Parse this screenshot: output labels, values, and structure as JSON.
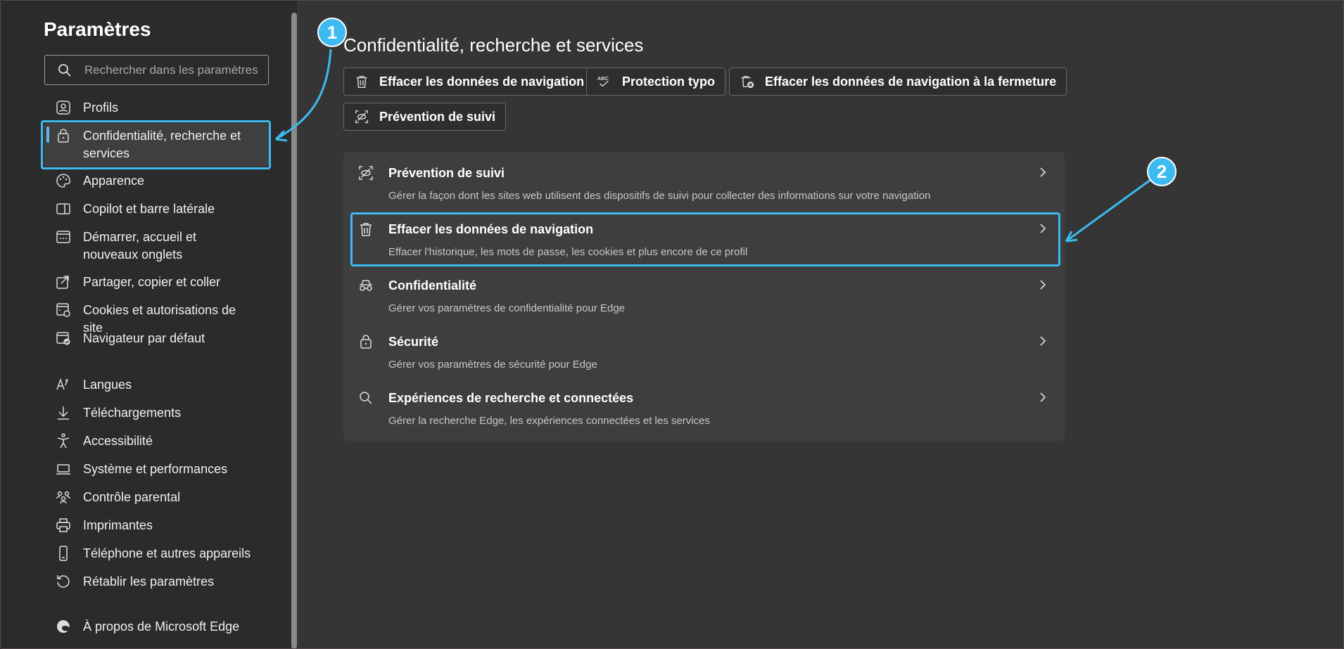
{
  "sidebar": {
    "title": "Paramètres",
    "search_placeholder": "Rechercher dans les paramètres",
    "items": [
      {
        "label": "Profils",
        "icon": "profile-icon"
      },
      {
        "label": "Confidentialité, recherche et services",
        "icon": "lock-icon",
        "active": true
      },
      {
        "label": "Apparence",
        "icon": "palette-icon"
      },
      {
        "label": "Copilot et barre latérale",
        "icon": "sidebar-icon"
      },
      {
        "label": "Démarrer, accueil et nouveaux onglets",
        "icon": "start-page-icon"
      },
      {
        "label": "Partager, copier et coller",
        "icon": "share-icon"
      },
      {
        "label": "Cookies et autorisations de site",
        "icon": "cookies-icon"
      },
      {
        "label": "Navigateur par défaut",
        "icon": "default-browser-icon"
      },
      {
        "label": "Langues",
        "icon": "languages-icon"
      },
      {
        "label": "Téléchargements",
        "icon": "download-icon"
      },
      {
        "label": "Accessibilité",
        "icon": "accessibility-icon"
      },
      {
        "label": "Système et performances",
        "icon": "laptop-icon"
      },
      {
        "label": "Contrôle parental",
        "icon": "family-icon"
      },
      {
        "label": "Imprimantes",
        "icon": "printer-icon"
      },
      {
        "label": "Téléphone et autres appareils",
        "icon": "phone-icon"
      },
      {
        "label": "Rétablir les paramètres",
        "icon": "reset-icon"
      },
      {
        "label": "À propos de Microsoft Edge",
        "icon": "edge-logo-icon"
      }
    ]
  },
  "main": {
    "title": "Confidentialité, recherche et services",
    "chips": [
      {
        "label": "Effacer les données de navigation",
        "icon": "trash-icon"
      },
      {
        "label": "Protection typo",
        "icon": "spellcheck-icon"
      },
      {
        "label": "Effacer les données de navigation à la fermeture",
        "icon": "trash-clock-icon"
      },
      {
        "label": "Prévention de suivi",
        "icon": "tracking-icon"
      }
    ],
    "rows": [
      {
        "title": "Prévention de suivi",
        "desc": "Gérer la façon dont les sites web utilisent des dispositifs de suivi pour collecter des informations sur votre navigation",
        "icon": "tracking-icon"
      },
      {
        "title": "Effacer les données de navigation",
        "desc": "Effacer l'historique, les mots de passe, les cookies et plus encore de ce profil",
        "icon": "trash-icon"
      },
      {
        "title": "Confidentialité",
        "desc": "Gérer vos paramètres de confidentialité pour Edge",
        "icon": "incognito-icon"
      },
      {
        "title": "Sécurité",
        "desc": "Gérer vos paramètres de sécurité pour Edge",
        "icon": "lock-icon"
      },
      {
        "title": "Expériences de recherche et connectées",
        "desc": "Gérer la recherche Edge, les expériences connectées et les services",
        "icon": "search-icon"
      }
    ]
  },
  "annotations": {
    "badge1": "1",
    "badge2": "2",
    "accent": "#3dbbf0"
  }
}
